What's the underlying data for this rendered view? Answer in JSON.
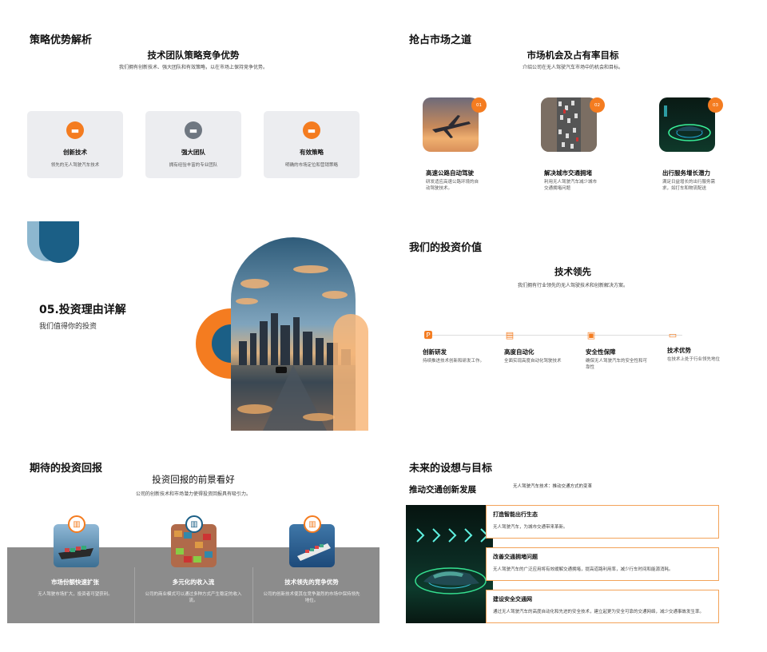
{
  "slide1": {
    "title": "策略优势解析",
    "heading": "技术团队策略竞争优势",
    "subtitle": "我们拥有创新技术、强大团队和有效策略，以在市场上保持竞争优势。",
    "cards": [
      {
        "title": "创新技术",
        "desc": "领先的无人驾驶汽车技术",
        "icon": "briefcase-icon",
        "color": "#f47c20"
      },
      {
        "title": "强大团队",
        "desc": "拥有经验丰富的专业团队",
        "icon": "briefcase-icon",
        "color": "#6f7781"
      },
      {
        "title": "有效策略",
        "desc": "明确的市场定位和营销策略",
        "icon": "briefcase-icon",
        "color": "#f47c20"
      }
    ]
  },
  "slide2": {
    "title": "抢占市场之道",
    "heading": "市场机会及占有率目标",
    "subtitle": "介绍公司在无人驾驶汽车市场中的机会和目标。",
    "items": [
      {
        "num": "01",
        "title": "高速公路自动驾驶",
        "desc": "研发适应高速公路环境的自动驾驶技术。"
      },
      {
        "num": "02",
        "title": "解决城市交通拥堵",
        "desc": "利用无人驾驶汽车减少城市交通拥堵问题"
      },
      {
        "num": "03",
        "title": "出行服务增长潜力",
        "desc": "满足日益增长的出行服务需求，如打车和物流配送"
      }
    ]
  },
  "slide3": {
    "title": "05.投资理由详解",
    "subtitle": "我们值得你的投资"
  },
  "slide4": {
    "title": "我们的投资价值",
    "heading": "技术领先",
    "subtitle": "我们拥有行业领先的无人驾驶技术和创新解决方案。",
    "items": [
      {
        "title": "创新研发",
        "desc": "持续推进技术创新和研发工作。",
        "icon": "parking-icon"
      },
      {
        "title": "高度自动化",
        "desc": "全面实现高度自动化驾驶技术",
        "icon": "toolbox-icon"
      },
      {
        "title": "安全性保障",
        "desc": "确保无人驾驶汽车的安全性和可靠性",
        "icon": "printer-icon"
      },
      {
        "title": "技术优势",
        "desc": "在技术上处于行业领先地位",
        "icon": "sofa-icon"
      }
    ]
  },
  "slide5": {
    "title": "期待的投资回报",
    "heading": "投资回报的前景看好",
    "subtitle": "公司的创新技术和市场潜力使得投资回报具有吸引力。",
    "items": [
      {
        "title": "市场份额快速扩张",
        "desc": "无人驾驶市场扩大，投资者可望获利。"
      },
      {
        "title": "多元化的收入流",
        "desc": "公司的商业模式可以通过多种方式产生稳定的收入流。"
      },
      {
        "title": "技术领先的竞争优势",
        "desc": "公司的创新技术使其在竞争激烈的市场中保持领先地位。"
      }
    ]
  },
  "slide6": {
    "title": "未来的设想与目标",
    "left_heading": "推动交通创新发展",
    "top_note": "无人驾驶汽车技术：推动交通方式的变革",
    "goals": [
      {
        "title": "打造智能出行生态",
        "desc": "无人驾驶汽车，为城市交通带来革新。"
      },
      {
        "title": "改善交通拥堵问题",
        "desc": "无人驾驶汽车的广泛应用将有效缓解交通拥堵，提高道路利用率，减少行车时间和能源消耗。"
      },
      {
        "title": "建设安全交通网",
        "desc": "通过无人驾驶汽车的高度自动化和先进的安全技术，建立起更为安全可靠的交通网络，减少交通事故发生率。"
      }
    ]
  }
}
